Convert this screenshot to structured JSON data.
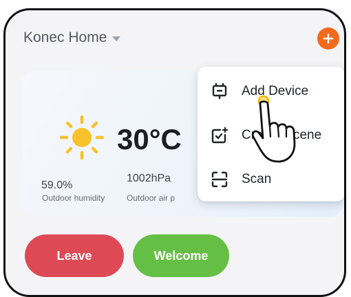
{
  "header": {
    "home_name": "Konec Home",
    "add_icon": "plus-icon",
    "dropdown_icon": "caret-down-icon"
  },
  "weather": {
    "icon": "sun-icon",
    "temperature": "30°C",
    "humidity_value": "59.0%",
    "humidity_label": "Outdoor humidity",
    "pressure_value": "1002hPa",
    "pressure_label": "Outdoor air p"
  },
  "menu": {
    "items": [
      {
        "label": "Add Device",
        "icon": "add-device-icon"
      },
      {
        "label": "Create Scene",
        "icon": "create-scene-icon"
      },
      {
        "label": "Scan",
        "icon": "scan-icon"
      }
    ]
  },
  "scenes": {
    "leave_label": "Leave",
    "welcome_label": "Welcome"
  },
  "colors": {
    "accent": "#f26a1b",
    "leave": "#dd4a56",
    "welcome": "#66bf45"
  }
}
